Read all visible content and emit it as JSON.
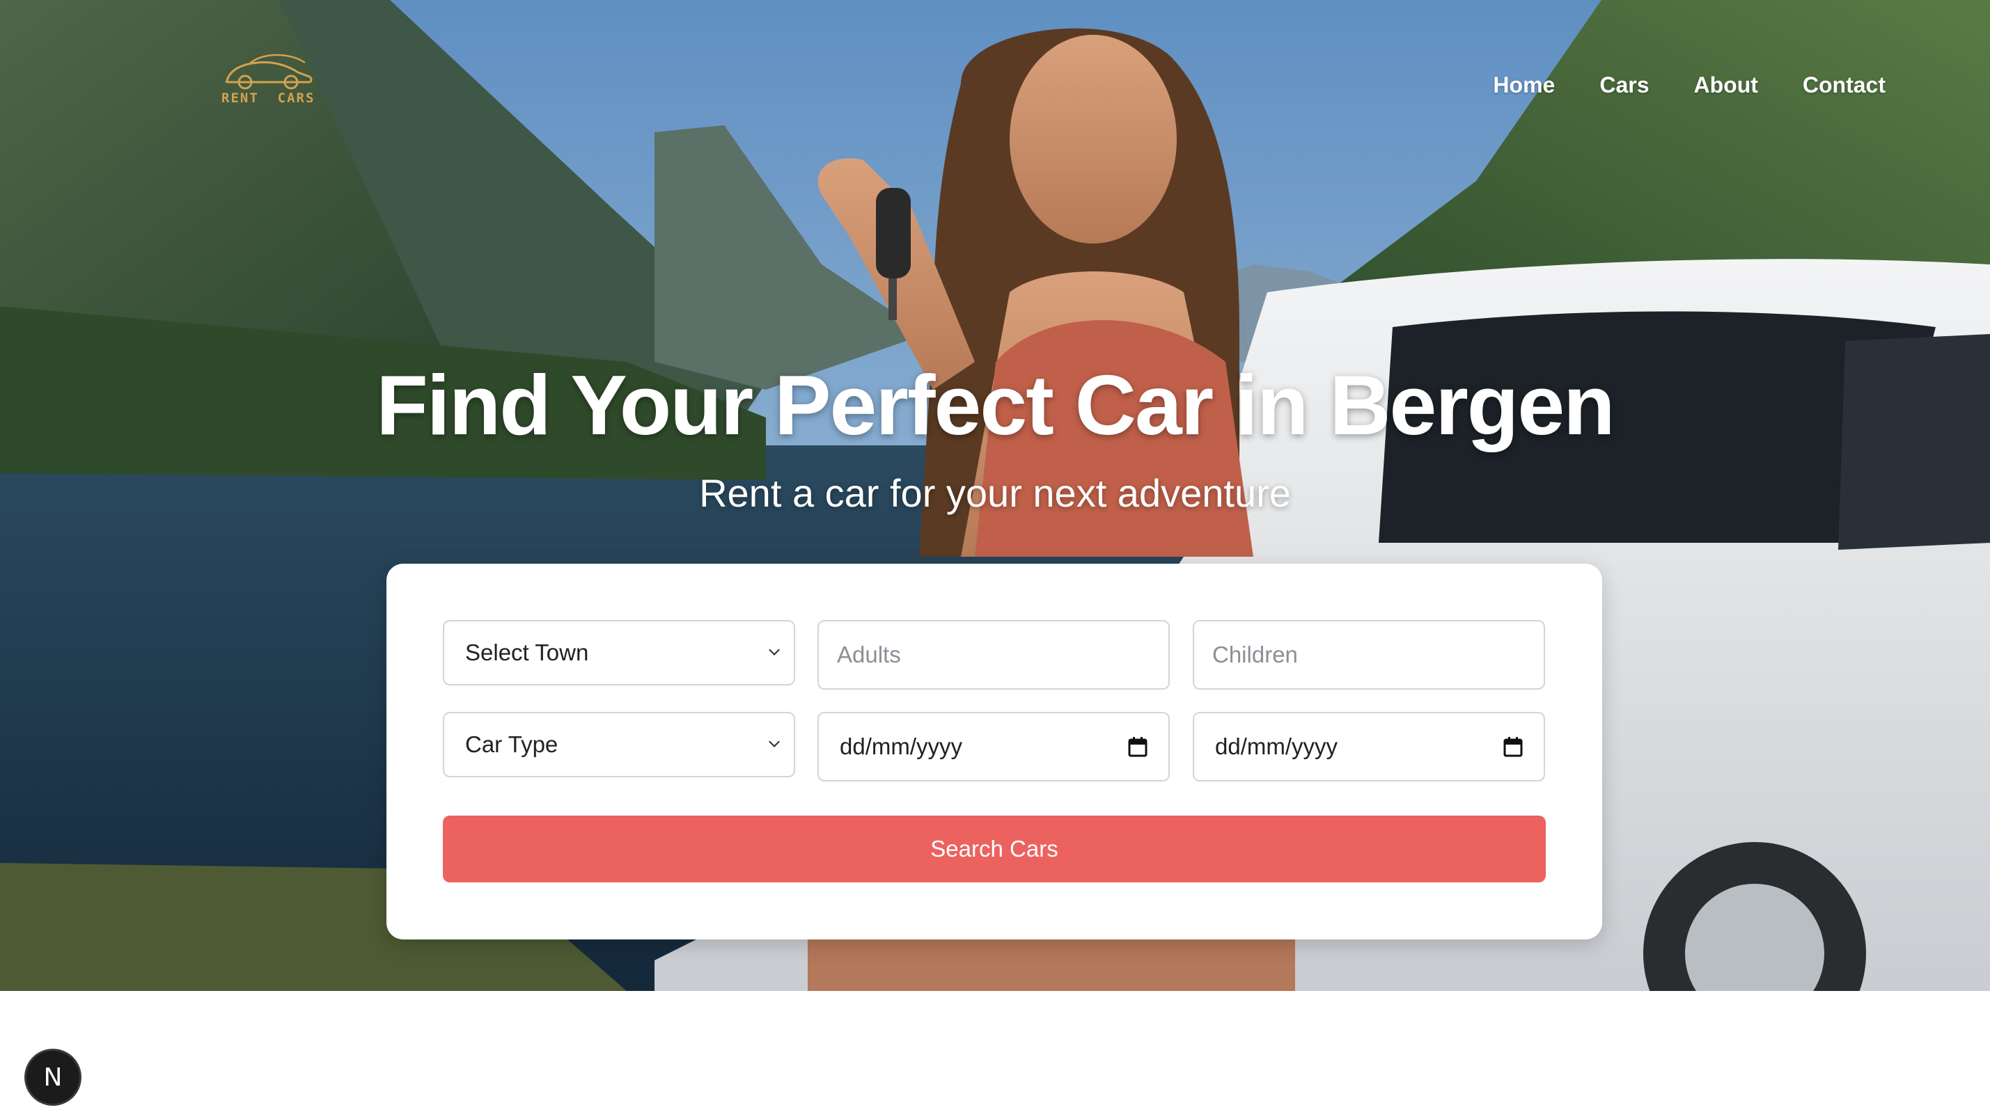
{
  "brand": {
    "logo_text": "RENT  CARS",
    "accent_color": "#d4a24c"
  },
  "nav": {
    "items": [
      {
        "label": "Home"
      },
      {
        "label": "Cars"
      },
      {
        "label": "About"
      },
      {
        "label": "Contact"
      }
    ]
  },
  "hero": {
    "title": "Find Your Perfect Car in Bergen",
    "subtitle": "Rent a car for your next adventure"
  },
  "search_form": {
    "town_select": {
      "value": "Select Town"
    },
    "adults": {
      "placeholder": "Adults"
    },
    "children": {
      "placeholder": "Children"
    },
    "car_type_select": {
      "value": "Car Type"
    },
    "pickup_date": {
      "value": "dd/mm/yyyy"
    },
    "return_date": {
      "value": "dd/mm/yyyy"
    },
    "submit_label": "Search Cars",
    "submit_color": "#ec625f"
  },
  "dev_badge": {
    "label": "N"
  }
}
